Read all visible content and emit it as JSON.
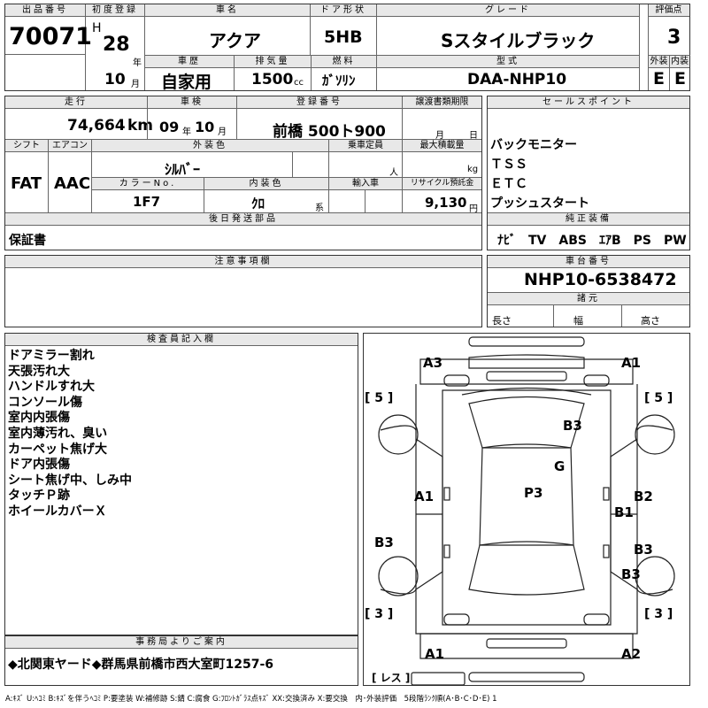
{
  "lot": {
    "label": "出品番号",
    "value": "70071"
  },
  "first_reg": {
    "label": "初度登録",
    "era": "H",
    "year": "28",
    "year_unit": "年",
    "month": "10",
    "month_unit": "月"
  },
  "car_name": {
    "label": "車名",
    "value": "アクア"
  },
  "door": {
    "label": "ドア形状",
    "value": "5HB"
  },
  "grade": {
    "label": "グレード",
    "value": "Sスタイルブラック"
  },
  "score": {
    "label": "評価点",
    "value": "3"
  },
  "history": {
    "label": "車歴",
    "value": "自家用"
  },
  "displacement": {
    "label": "排気量",
    "value": "1500",
    "unit": "cc"
  },
  "fuel": {
    "label": "燃料",
    "value": "ｶﾞｿﾘﾝ"
  },
  "model": {
    "label": "型式",
    "value": "DAA-NHP10"
  },
  "exterior": {
    "label": "外装",
    "value": "E"
  },
  "interior": {
    "label": "内装",
    "value": "E"
  },
  "mileage": {
    "label": "走行",
    "value": "74,664",
    "unit": "km"
  },
  "inspection": {
    "label": "車検",
    "year": "09",
    "year_unit": "年",
    "month": "10",
    "month_unit": "月"
  },
  "plate": {
    "label": "登録番号",
    "value": "前橋 500ト900"
  },
  "transfer": {
    "label": "譲渡書類期限",
    "month_unit": "月",
    "day_unit": "日"
  },
  "shift": {
    "label": "シフト",
    "value": "FAT"
  },
  "aircon": {
    "label": "エアコン",
    "value": "AAC"
  },
  "ext_color": {
    "label": "外装色",
    "value": "ｼﾙﾊﾞｰ"
  },
  "capacity": {
    "label": "乗車定員",
    "unit": "人"
  },
  "max_load": {
    "label": "最大積載量",
    "unit": "kg"
  },
  "color_no": {
    "label": "カラーNo.",
    "value": "1F7"
  },
  "int_color": {
    "label": "内装色",
    "value": "ｸﾛ",
    "unit": "系"
  },
  "import": {
    "label": "輸入車"
  },
  "recycle": {
    "label": "リサイクル預託金",
    "value": "9,130",
    "unit": "円"
  },
  "sales_points": {
    "label": "セールスポイント",
    "items": [
      "バックモニター",
      "ＴＳＳ",
      "ＥＴＣ",
      "プッシュスタート"
    ]
  },
  "later_parts": {
    "label": "後日発送部品",
    "value": "保証書"
  },
  "genuine": {
    "label": "純正装備",
    "value": "ﾅﾋﾞ　TV　ABS　ｴｱB　PS　PW"
  },
  "notes": {
    "label": "注意事項欄"
  },
  "chassis": {
    "label": "車台番号",
    "value": "NHP10-6538472"
  },
  "specs": {
    "label": "諸元",
    "length": "長さ",
    "width": "幅",
    "height": "高さ"
  },
  "inspector": {
    "label": "検査員記入欄",
    "lines": [
      "ドアミラー割れ",
      "天張汚れ大",
      "ハンドルすれ大",
      "コンソール傷",
      "室内内張傷",
      "室内薄汚れ、臭い",
      "カーペット焦げ大",
      "ドア内張傷",
      "シート焦げ中、しみ中",
      "タッチＰ跡",
      "ホイールカバーＸ"
    ]
  },
  "office": {
    "label": "事務局よりご案内",
    "value": "◆北関東ヤード◆群馬県前橋市西大室町1257-6"
  },
  "legend": "A:ｷｽﾞ U:ﾍｺﾐ B:ｷｽﾞを伴うﾍｺﾐ P:要塗装 W:補修跡 S:錆 C:腐食 G:ﾌﾛﾝﾄｶﾞﾗｽ点ｷｽﾞ XX:交換済み X:要交換　内･外装評価　5段階ﾗﾝｸ順(A･B･C･D･E) 1",
  "diagram": {
    "marks": [
      "A3",
      "A1",
      "B3",
      "G",
      "A1",
      "P3",
      "B2",
      "B1",
      "B3",
      "B3",
      "B3",
      "A1",
      "A2"
    ],
    "tires": [
      "[ 5 ]",
      "[ 5 ]",
      "[ 3 ]",
      "[ 3 ]"
    ],
    "spare": "[ レス ]"
  }
}
